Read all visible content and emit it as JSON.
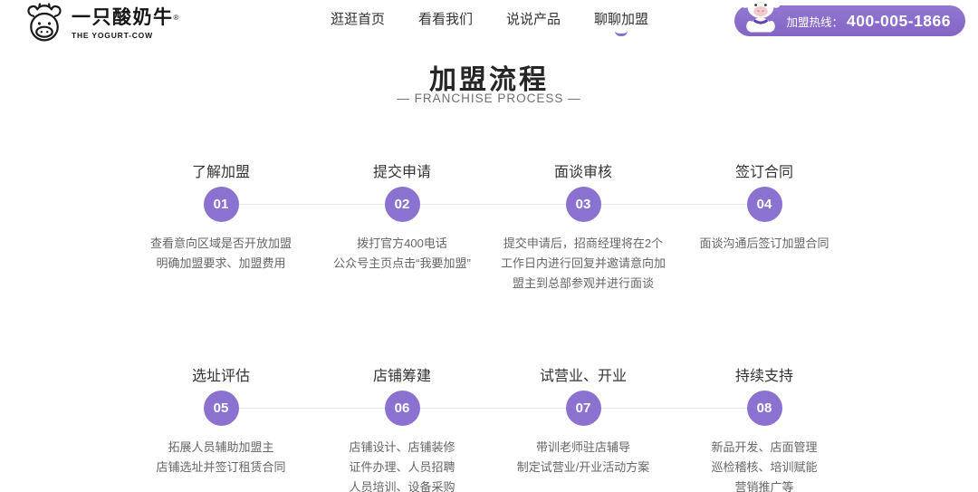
{
  "colors": {
    "accent_purple": "#8b72d0",
    "pill_purple": "#8a6cc8",
    "connector_gray": "#e8e8e8",
    "title_dark": "#262626",
    "desc_gray": "#666666"
  },
  "header": {
    "logo": {
      "name_zh": "一只酸奶牛",
      "trademark": "®",
      "name_en": "THE YOGURT-COW"
    },
    "nav": [
      {
        "label": "逛逛首页",
        "active": false
      },
      {
        "label": "看看我们",
        "active": false
      },
      {
        "label": "说说产品",
        "active": false
      },
      {
        "label": "聊聊加盟",
        "active": true
      }
    ],
    "hotline": {
      "label": "加盟热线：",
      "number": "400-005-1866"
    }
  },
  "section": {
    "title": "加盟流程",
    "subtitle": "— FRANCHISE PROCESS —"
  },
  "steps": [
    {
      "num": "01",
      "title": "了解加盟",
      "desc": [
        "查看意向区域是否开放加盟",
        "明确加盟要求、加盟费用"
      ]
    },
    {
      "num": "02",
      "title": "提交申请",
      "desc": [
        "拨打官方400电话",
        "公众号主页点击“我要加盟”"
      ]
    },
    {
      "num": "03",
      "title": "面谈审核",
      "desc": [
        "提交申请后，招商经理将在2个",
        "工作日内进行回复并邀请意向加",
        "盟主到总部参观并进行面谈"
      ]
    },
    {
      "num": "04",
      "title": "签订合同",
      "desc": [
        "面谈沟通后签订加盟合同"
      ]
    },
    {
      "num": "05",
      "title": "选址评估",
      "desc": [
        "拓展人员辅助加盟主",
        "店铺选址并签订租赁合同"
      ]
    },
    {
      "num": "06",
      "title": "店铺筹建",
      "desc": [
        "店铺设计、店铺装修",
        "证件办理、人员招聘",
        "人员培训、设备采购"
      ]
    },
    {
      "num": "07",
      "title": "试营业、开业",
      "desc": [
        "带训老师驻店辅导",
        "制定试营业/开业活动方案"
      ]
    },
    {
      "num": "08",
      "title": "持续支持",
      "desc": [
        "新品开发、店面管理",
        "巡检稽核、培训赋能",
        "营销推广等"
      ]
    }
  ]
}
